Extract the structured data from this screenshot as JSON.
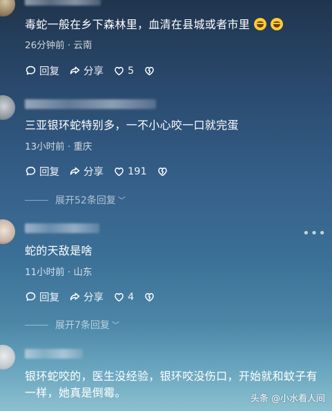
{
  "comments": [
    {
      "text": "毒蛇一般在乡下森林里，血清在县城或者市里",
      "meta": "26分钟前 · 云南",
      "reply": "回复",
      "share": "分享",
      "likes": "5",
      "emojis": [
        "laughing-tears-emoji",
        "laughing-tears-emoji"
      ]
    },
    {
      "text": "三亚银环蛇特别多，一不小心咬一口就完蛋",
      "meta": "13小时前 · 重庆",
      "reply": "回复",
      "share": "分享",
      "likes": "191",
      "expand": "展开52条回复"
    },
    {
      "text": "蛇的天敌是啥",
      "meta": "11小时前 · 山东",
      "reply": "回复",
      "share": "分享",
      "likes": "4",
      "expand": "展开7条回复"
    },
    {
      "text": "银环蛇咬的，医生没经验，银环咬没伤口，开始就和蚊子有一样，她真是倒霉。"
    }
  ],
  "more": "•••",
  "watermark": "头条 @小水看人间"
}
